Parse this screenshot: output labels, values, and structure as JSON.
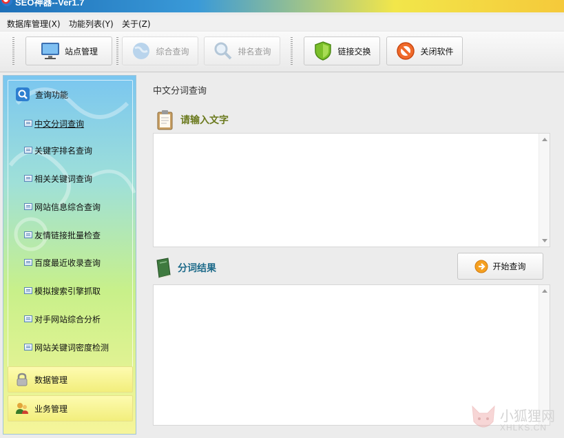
{
  "window": {
    "title": "SEO神器--Ver1.7"
  },
  "menu": [
    "数据库管理(X)",
    "功能列表(Y)",
    "关于(Z)"
  ],
  "toolbar": {
    "site_manage": "站点管理",
    "combined_query": "综合查询",
    "rank_query": "排名查询",
    "link_exchange": "链接交换",
    "close_software": "关闭软件"
  },
  "sidebar": {
    "query_header": "查询功能",
    "items": [
      "中文分词查询",
      "关键字排名查询",
      "相关关键词查询",
      "网站信息综合查询",
      "友情链接批量检查",
      "百度最近收录查询",
      "模拟搜索引擎抓取",
      "对手网站综合分析",
      "网站关键词密度检测"
    ],
    "active_index": 0,
    "data_manage": "数据管理",
    "business_manage": "业务管理"
  },
  "main": {
    "title": "中文分词查询",
    "input_heading": "请输入文字",
    "result_heading": "分词结果",
    "start_button": "开始查询",
    "input_value": "",
    "result_value": ""
  },
  "watermark": {
    "text": "小狐狸网",
    "sub": "XHLKS.CN"
  }
}
